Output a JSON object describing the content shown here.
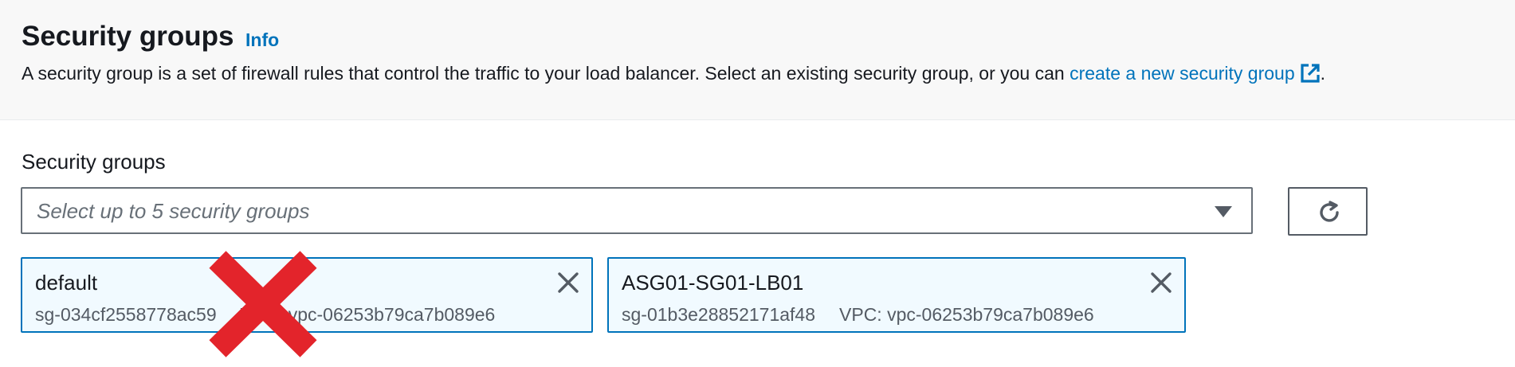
{
  "header": {
    "title": "Security groups",
    "info_link": "Info",
    "description_text": "A security group is a set of firewall rules that control the traffic to your load balancer. Select an existing security group, or you can ",
    "description_link": "create a new security group",
    "description_end": "."
  },
  "field": {
    "label": "Security groups",
    "placeholder": "Select up to 5 security groups"
  },
  "icons": {
    "external_link": "external-link-icon",
    "caret": "caret-down-icon",
    "refresh": "refresh-icon",
    "close": "close-icon",
    "overlay": "red-x-mark"
  },
  "selected_groups": [
    {
      "name": "default",
      "id": "sg-034cf2558778ac59",
      "vpc": "VPC: vpc-06253b79ca7b089e6"
    },
    {
      "name": "ASG01-SG01-LB01",
      "id": "sg-01b3e28852171af48",
      "vpc": "VPC: vpc-06253b79ca7b089e6"
    }
  ],
  "colors": {
    "link": "#0073bb",
    "token_bg": "#f1faff",
    "token_border": "#0073bb",
    "overlay_red": "#e3242b",
    "header_bg": "#f8f8f8"
  }
}
